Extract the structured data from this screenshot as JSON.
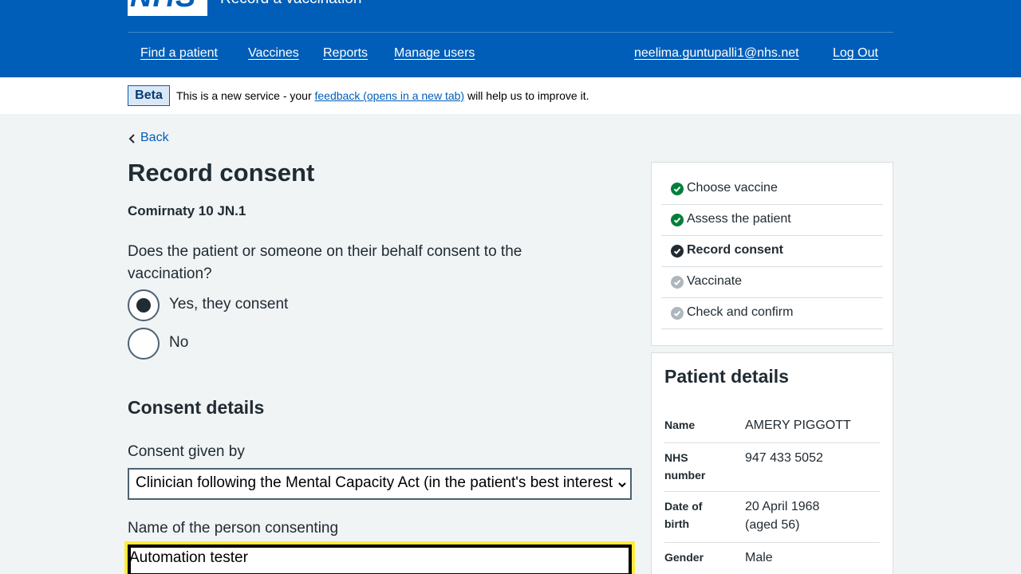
{
  "header": {
    "logo_text": "NHS",
    "service_name": "Record a vaccination",
    "nav": {
      "find_patient": "Find a patient",
      "vaccines": "Vaccines",
      "reports": "Reports",
      "manage_users": "Manage users",
      "user_email": "neelima.guntupalli1@nhs.net",
      "log_out": "Log Out"
    },
    "brand_color": "#005eb8"
  },
  "beta_banner": {
    "tag": "Beta",
    "text_before": "This is a new service - your ",
    "link": "feedback (opens in a new tab)",
    "text_after": " will help us to improve it."
  },
  "back_link": "Back",
  "page_title": "Record consent",
  "vaccine_caption": "Comirnaty 10 JN.1",
  "consent_question": "Does the patient or someone on their behalf consent to the vaccination?",
  "consent_options": [
    {
      "label": "Yes, they consent",
      "selected": true
    },
    {
      "label": "No",
      "selected": false
    }
  ],
  "consent_details": {
    "heading": "Consent details",
    "given_by_label": "Consent given by",
    "given_by_value": "Clinician following the Mental Capacity Act (in the patient's best interests)",
    "name_label": "Name of the person consenting",
    "name_value": "Automation tester"
  },
  "steps": [
    {
      "label": "Choose vaccine",
      "status": "complete",
      "icon": "check-circle-icon",
      "color": "#007f3b"
    },
    {
      "label": "Assess the patient",
      "status": "complete",
      "icon": "check-circle-icon",
      "color": "#007f3b"
    },
    {
      "label": "Record consent",
      "status": "current",
      "icon": "check-circle-icon",
      "color": "#212b32"
    },
    {
      "label": "Vaccinate",
      "status": "pending",
      "icon": "check-circle-icon",
      "color": "#aeb7bd"
    },
    {
      "label": "Check and confirm",
      "status": "pending",
      "icon": "check-circle-icon",
      "color": "#aeb7bd"
    }
  ],
  "patient_details": {
    "title": "Patient details",
    "name_key": "Name",
    "name": "AMERY PIGGOTT",
    "nhs_key": "NHS number",
    "nhs_number": "947 433 5052",
    "dob_key": "Date of birth",
    "dob": "20 April 1968",
    "age": "(aged 56)",
    "gender_key": "Gender",
    "gender": "Male"
  },
  "focus_color": "#ffeb3b"
}
